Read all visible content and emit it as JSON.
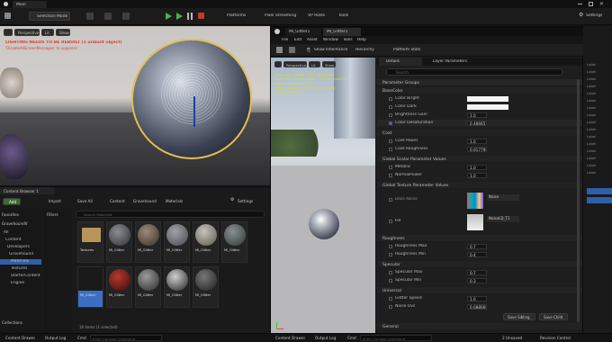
{
  "main_tab": "Main",
  "toolbar": {
    "selection_mode": "Selection Mode",
    "platforms": "Platforms",
    "pixel_streaming": "Pixel Streaming",
    "vp_roles": "VP Roles",
    "tools": "Tools",
    "settings": "Settings"
  },
  "viewport": {
    "perspective": "Perspective",
    "lit": "Lit",
    "show": "Show",
    "warning": "LIGHTING NEEDS TO BE REBUILT (1 unbuilt object)",
    "warning2": "'DisableAllScreenMessages' to suppress"
  },
  "material_editor": {
    "tabs": [
      "MI_Glitter1",
      "MI_Glitter1"
    ],
    "menu": [
      "File",
      "Edit",
      "Asset",
      "Window",
      "Tools",
      "Help"
    ],
    "toolbar": [
      "Save",
      "Show Inheritance",
      "Hierarchy",
      "Platform Stats"
    ],
    "viewport_btn": [
      "Perspective",
      "Lit",
      "Show"
    ],
    "stats": [
      "Base pass shader: 326 instructions",
      "Base pass vertex shader: 167 instructions",
      "Texture samplers: 7/16",
      "Texture Lookups (Est.): VS(0), PS(3)",
      "Shader Count: 34"
    ],
    "details_tab": "Details",
    "layer_tab": "Layer Parameters",
    "search_placeholder": "Search",
    "sections": {
      "param_groups": "Parameter Groups",
      "base_color": "BaseColor",
      "coat": "Coat",
      "global_scalar": "Global Scalar Parameter Values",
      "global_texture": "Global Texture Parameter Values",
      "roughness": "Roughness",
      "specular": "Specular",
      "universal": "Universal",
      "general": "General"
    },
    "params": {
      "color_bright": "Color Bright",
      "color_dark": "Color Dark",
      "brightness_gain": "Brightness Gain",
      "brightness_gain_val": "1.0",
      "color_desaturation": "Color Desaturation",
      "color_desaturation_val": "0.486657",
      "coat_power": "Coat Power",
      "coat_power_val": "1.0",
      "coat_roughness": "Coat Roughness",
      "coat_roughness_val": "0.017796",
      "metallic": "Metallic",
      "metallic_val": "1.0",
      "normal_power": "NormalPower",
      "normal_power_val": "1.0",
      "base_noise": "Base Noise",
      "base_noise_tex": "Noise",
      "fill": "Fill",
      "fill_tex": "NoiseLD_T1",
      "roughness_max": "Roughness Max",
      "roughness_max_val": "0.7",
      "roughness_min": "Roughness Min",
      "roughness_min_val": "0.4",
      "specular_max": "Specular Max",
      "specular_max_val": "0.7",
      "specular_min": "Specular Min",
      "specular_min_val": "0.3",
      "glitter_speed": "Glitter Speed",
      "glitter_speed_val": "1.0",
      "noise_uvs": "Noise Uvs",
      "noise_uvs_val": "0.088060"
    },
    "save_sibling": "Save Sibling",
    "save_child": "Save Child"
  },
  "content_browser": {
    "tab": "Content Browser 1",
    "add": "Add",
    "import": "Import",
    "save_all": "Save All",
    "path": [
      "Content",
      "Gravehound",
      "Materials"
    ],
    "settings": "Settings",
    "favorites": "Favorites",
    "project": "GravehoundV",
    "filters": "Filters",
    "search_placeholder": "Search Materials",
    "folders": [
      "All",
      "Content",
      "Developers",
      "Gravehound",
      "Materials",
      "Textures",
      "StarterContent",
      "Engine"
    ],
    "collections": "Collections",
    "status": "16 items (1 selected)",
    "assets": [
      {
        "label": "Textures",
        "kind": "folder"
      },
      {
        "label": "MI_Glitter",
        "kind": "sphere",
        "c1": "#8a8d93",
        "c2": "#2f3035"
      },
      {
        "label": "MI_Glitter",
        "kind": "sphere",
        "c1": "#9a8a7a",
        "c2": "#3a3028"
      },
      {
        "label": "MI_Glitter",
        "kind": "sphere",
        "c1": "#a0a4aa",
        "c2": "#44474c"
      },
      {
        "label": "MI_Glitter",
        "kind": "sphere",
        "c1": "#c8c2ba",
        "c2": "#5a5550"
      },
      {
        "label": "MI_Glitter",
        "kind": "sphere",
        "c1": "#8a9090",
        "c2": "#303838"
      },
      {
        "label": "MI_Glitter",
        "kind": "selected"
      },
      {
        "label": "MI_Glitter",
        "kind": "sphere",
        "c1": "#b23a30",
        "c2": "#3a0c0a"
      },
      {
        "label": "MI_Glitter",
        "kind": "sphere",
        "c1": "#9b9b9b",
        "c2": "#2a2a2a"
      },
      {
        "label": "MI_Glitter",
        "kind": "sphere",
        "c1": "#cfcfcf",
        "c2": "#202020"
      },
      {
        "label": "MI_Glitter",
        "kind": "sphere",
        "c1": "#777777",
        "c2": "#1f1f1f"
      }
    ]
  },
  "bottom_bar": {
    "content_drawer": "Content Drawer",
    "output_log": "Output Log",
    "cmd": "Cmd",
    "console_placeholder": "Enter Console Command",
    "unsaved": "2 Unsaved",
    "revision_control": "Revision Control"
  },
  "outliner_rows": [
    "Label",
    "Label",
    "Label",
    "Label",
    "Label",
    "Label",
    "Label",
    "Label",
    "Label",
    "Label",
    "Label",
    "Label",
    "Label",
    "Label",
    "Label",
    "Label"
  ]
}
